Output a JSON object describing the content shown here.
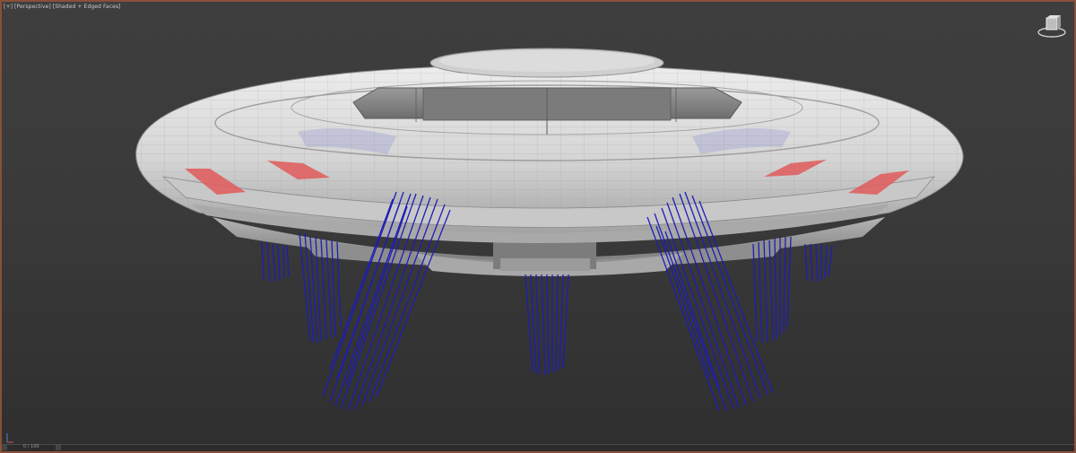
{
  "viewport": {
    "label_plus": "[+]",
    "label_view": "[Perspective]",
    "label_shading": "[Shaded + Edged Faces]"
  },
  "timeline": {
    "frame_text": "0 / 100"
  },
  "colors": {
    "frame_border": "#8a4f3a",
    "hull": "#d9d9d9",
    "wire": "#1d1db8",
    "light_red": "#e05a5a"
  },
  "icons": [
    "viewcube-icon",
    "axis-gizmo-icon"
  ]
}
